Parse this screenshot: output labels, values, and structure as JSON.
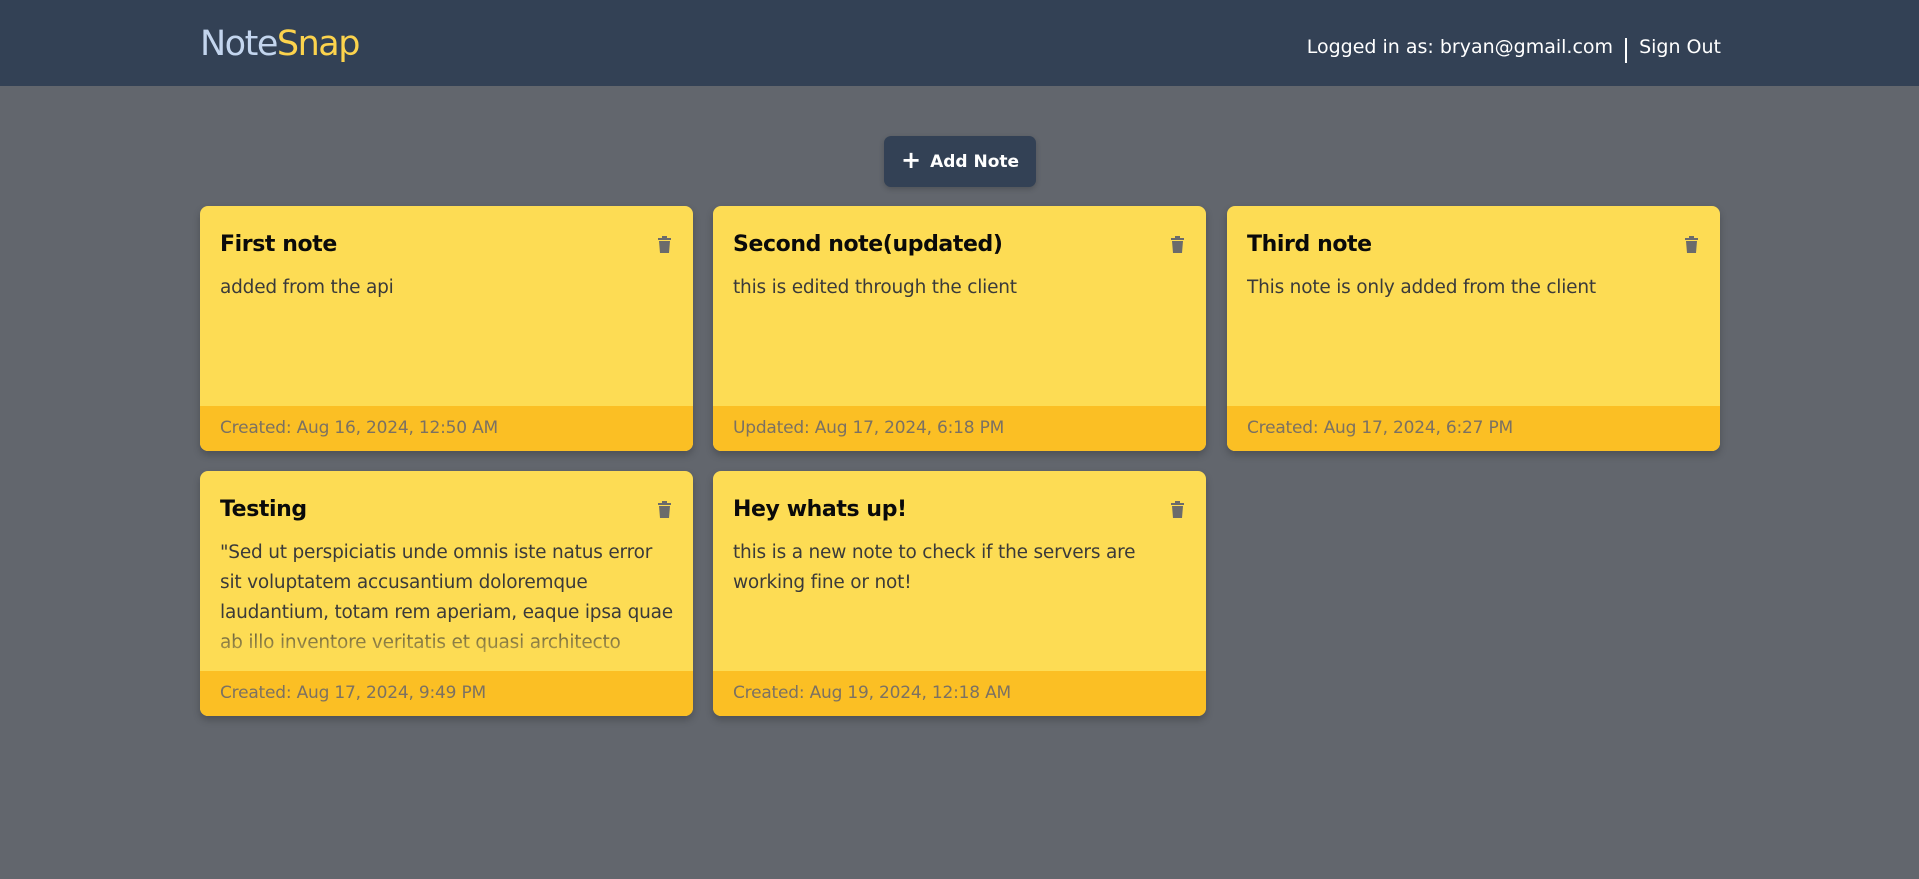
{
  "header": {
    "brand_part1": "Note",
    "brand_part2": "Snap",
    "logged_in_text": "Logged in as: bryan@gmail.com",
    "sign_out_label": "Sign Out",
    "background_color": "#334155"
  },
  "toolbar": {
    "add_note_label": "Add Note",
    "add_icon": "+"
  },
  "notes": [
    {
      "title": "First note",
      "body": "added from the api",
      "footer": "Created: Aug 16, 2024, 12:50 AM"
    },
    {
      "title": "Second note(updated)",
      "body": "this is edited through the client",
      "footer": "Updated: Aug 17, 2024, 6:18 PM"
    },
    {
      "title": "Third note",
      "body": "This note is only added from the client",
      "footer": "Created: Aug 17, 2024, 6:27 PM"
    },
    {
      "title": "Testing",
      "body": "\"Sed ut perspiciatis unde omnis iste natus error sit voluptatem accusantium doloremque laudantium, totam rem aperiam, eaque ipsa quae ab illo inventore veritatis et quasi architecto beatae vitae",
      "footer": "Created: Aug 17, 2024, 9:49 PM"
    },
    {
      "title": "Hey whats up!",
      "body": "this is a new note to check if the servers are working fine or not!",
      "footer": "Created: Aug 19, 2024, 12:18 AM"
    }
  ],
  "colors": {
    "page_bg": "#62666d",
    "note_bg": "#fddc54",
    "note_footer_bg": "#fbbf24",
    "brand_accent": "#fcd34d"
  }
}
